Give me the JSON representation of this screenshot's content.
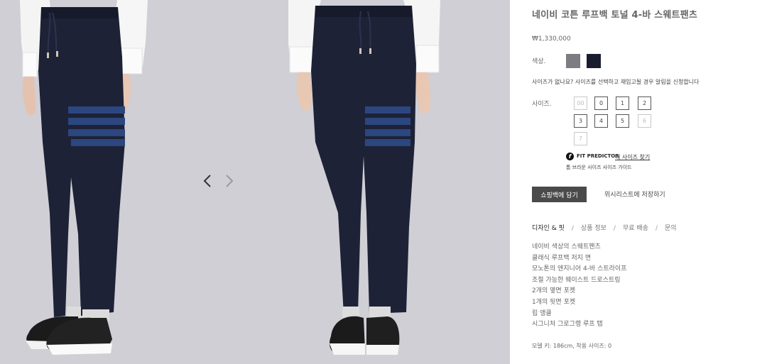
{
  "product": {
    "title": "네이비 코튼 루프백 토널 4-바 스웨트팬츠",
    "price": "₩1,330,000"
  },
  "colors": {
    "label": "색상.",
    "swatches": [
      {
        "name": "grey",
        "hex": "#7d7c82"
      },
      {
        "name": "navy",
        "hex": "#1a1d2e"
      }
    ]
  },
  "size_notice": "사이즈가 없나요? 사이즈를 선택하고 재입고될 경우 알림을 신청합니다",
  "sizes": {
    "label": "사이즈.",
    "options": [
      {
        "label": "00",
        "available": false
      },
      {
        "label": "0",
        "available": true
      },
      {
        "label": "1",
        "available": true
      },
      {
        "label": "2",
        "available": true
      },
      {
        "label": "3",
        "available": true
      },
      {
        "label": "4",
        "available": true
      },
      {
        "label": "5",
        "available": true
      },
      {
        "label": "6",
        "available": false
      },
      {
        "label": "7",
        "available": false
      }
    ]
  },
  "fit_predictor": {
    "icon_letter": "f",
    "label": "FIT PREDICTOR",
    "link": "내 사이즈 찾기",
    "guide": "톰 브라운 사이즈 사이즈 가이드"
  },
  "actions": {
    "add_to_bag": "쇼핑백에 담기",
    "wishlist": "위시리스트에 저장하기"
  },
  "tabs": {
    "items": [
      "디자인 & 핏",
      "상품 정보",
      "무료 배송",
      "문의"
    ],
    "separator": "/"
  },
  "details": [
    "네이비 색상의 스웨트팬츠",
    "클래식 루프백 저지 면",
    "모노톤의 앤지니어 4-바 스트라이프",
    "조절 가능한 웨이스트 드로스트링",
    "2개의 옆면 포켓",
    "1개의 뒷면 포켓",
    "립 앵클",
    "시그니처 그로그랭 루프 탭"
  ],
  "model_info": "모델 키: 186cm, 착용 사이즈: 0",
  "gallery": {
    "prev_icon": "chevron-left-icon",
    "next_icon": "chevron-right-icon"
  }
}
